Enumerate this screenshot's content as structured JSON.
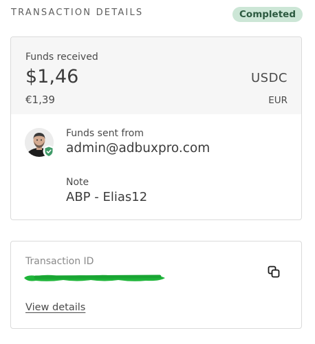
{
  "header": {
    "title": "TRANSACTION DETAILS",
    "status": "Completed",
    "status_color": "#cce6d6"
  },
  "funds": {
    "label": "Funds received",
    "amount": "$1,46",
    "currency": "USDC",
    "fiat_amount": "€1,39",
    "fiat_currency": "EUR"
  },
  "sender": {
    "avatar": "user-avatar",
    "verified_icon": "shield-check-icon",
    "label": "Funds sent from",
    "value": "admin@adbuxpro.com"
  },
  "note": {
    "label": "Note",
    "value": "ABP - Elias12"
  },
  "transaction": {
    "label": "Transaction ID",
    "redaction_color": "#1fb53a",
    "copy_icon": "copy-icon",
    "view_details": "View details"
  }
}
